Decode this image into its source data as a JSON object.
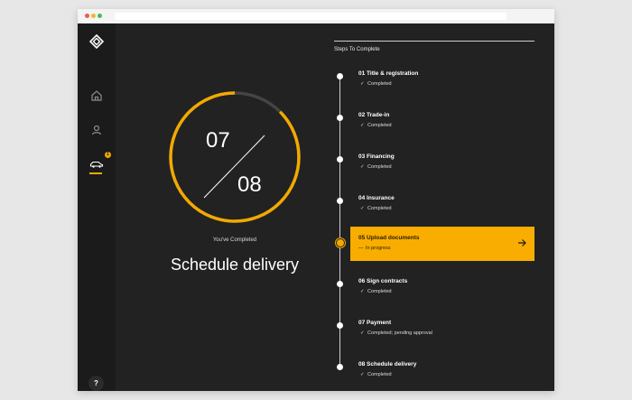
{
  "sidebar": {
    "logo": "diamond-logo",
    "items": [
      {
        "name": "home",
        "icon": "home-icon"
      },
      {
        "name": "profile",
        "icon": "user-icon"
      },
      {
        "name": "vehicle",
        "icon": "car-icon",
        "badge": "1",
        "active": true
      }
    ],
    "help_label": "?"
  },
  "progress": {
    "completed": "07",
    "total": "08",
    "label": "You've Completed",
    "current_step": "Schedule delivery",
    "accent": "#f2a900"
  },
  "steps_panel": {
    "title": "Steps To Complete",
    "steps": [
      {
        "title": "01 Title & registration",
        "status": "Completed",
        "state": "done"
      },
      {
        "title": "02 Trade-in",
        "status": "Completed",
        "state": "done"
      },
      {
        "title": "03 Financing",
        "status": "Completed",
        "state": "done"
      },
      {
        "title": "04 Insurance",
        "status": "Completed",
        "state": "done"
      },
      {
        "title": "05 Upload documents",
        "status": "In progress",
        "state": "active"
      },
      {
        "title": "06 Sign contracts",
        "status": "Completed",
        "state": "done"
      },
      {
        "title": "07 Payment",
        "status": "Completed; pending approval",
        "state": "done"
      },
      {
        "title": "08 Schedule delivery",
        "status": "Completed",
        "state": "done"
      }
    ]
  }
}
